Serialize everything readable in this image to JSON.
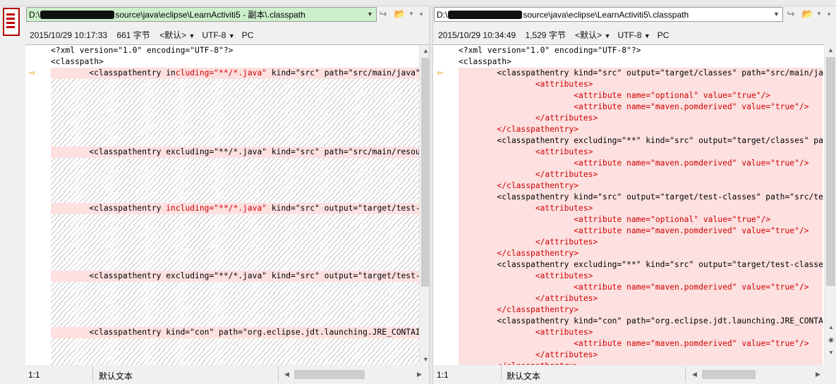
{
  "left": {
    "path_prefix": "D:\\",
    "path_suffix": "source\\java\\eclipse\\LearnActiviti5 - 副本\\.classpath",
    "timestamp": "2015/10/29 10:17:33",
    "size": "661 字节",
    "encoding_mode": "<默认>",
    "charset": "UTF-8",
    "line_ending": "PC",
    "cursor_pos": "1:1",
    "text_mode": "默认文本",
    "lines": [
      {
        "text": "<?xml version=\"1.0\" encoding=\"UTF-8\"?>",
        "style": "normal"
      },
      {
        "text": "<classpath>",
        "style": "normal"
      },
      {
        "pre": "        <classpathentry in",
        "red": "cluding=\"**/*.java\"",
        "post": " kind=\"src\" path=\"src/main/java\"/>",
        "style": "diff"
      },
      {
        "text": "",
        "style": "hatch"
      },
      {
        "text": "",
        "style": "hatch"
      },
      {
        "text": "",
        "style": "hatch"
      },
      {
        "text": "",
        "style": "hatch"
      },
      {
        "text": "",
        "style": "hatch"
      },
      {
        "text": "",
        "style": "hatch"
      },
      {
        "text": "        <classpathentry excluding=\"**/*.java\" kind=\"src\" path=\"src/main/resources\"/>",
        "style": "diff"
      },
      {
        "text": "",
        "style": "hatch"
      },
      {
        "text": "",
        "style": "hatch"
      },
      {
        "text": "",
        "style": "hatch"
      },
      {
        "text": "",
        "style": "hatch"
      },
      {
        "pre": "        <classpathentry ",
        "red": "including=\"**/*.java\"",
        "post": " kind=\"src\" output=\"target/test-classes\"",
        "style": "diff"
      },
      {
        "text": "",
        "style": "hatch"
      },
      {
        "text": "",
        "style": "hatch"
      },
      {
        "text": "",
        "style": "hatch"
      },
      {
        "text": "",
        "style": "hatch"
      },
      {
        "text": "",
        "style": "hatch"
      },
      {
        "text": "        <classpathentry excluding=\"**/*.java\" kind=\"src\" output=\"target/test-classes\"",
        "style": "diff"
      },
      {
        "text": "",
        "style": "hatch"
      },
      {
        "text": "",
        "style": "hatch"
      },
      {
        "text": "",
        "style": "hatch"
      },
      {
        "text": "",
        "style": "hatch"
      },
      {
        "text": "        <classpathentry kind=\"con\" path=\"org.eclipse.jdt.launching.JRE_CONTAINER\"/>",
        "style": "diff"
      },
      {
        "text": "",
        "style": "hatch"
      },
      {
        "text": "",
        "style": "hatch"
      },
      {
        "text": "",
        "style": "hatch"
      }
    ]
  },
  "right": {
    "path_prefix": "D:\\",
    "path_suffix": "source\\java\\eclipse\\LearnActiviti5\\.classpath",
    "timestamp": "2015/10/29 10:34:49",
    "size": "1,529 字节",
    "encoding_mode": "<默认>",
    "charset": "UTF-8",
    "line_ending": "PC",
    "cursor_pos": "1:1",
    "text_mode": "默认文本",
    "lines": [
      {
        "text": "<?xml version=\"1.0\" encoding=\"UTF-8\"?>",
        "style": "normal"
      },
      {
        "text": "<classpath>",
        "style": "normal"
      },
      {
        "text": "        <classpathentry kind=\"src\" output=\"target/classes\" path=\"src/main/java\">",
        "style": "solid"
      },
      {
        "text": "                <attributes>",
        "style": "solid-red"
      },
      {
        "text": "                        <attribute name=\"optional\" value=\"true\"/>",
        "style": "solid-red"
      },
      {
        "text": "                        <attribute name=\"maven.pomderived\" value=\"true\"/>",
        "style": "solid-red"
      },
      {
        "text": "                </attributes>",
        "style": "solid-red"
      },
      {
        "text": "        </classpathentry>",
        "style": "solid-red"
      },
      {
        "text": "        <classpathentry excluding=\"**\" kind=\"src\" output=\"target/classes\" path",
        "style": "solid"
      },
      {
        "text": "                <attributes>",
        "style": "solid-red"
      },
      {
        "text": "                        <attribute name=\"maven.pomderived\" value=\"true\"/>",
        "style": "solid-red"
      },
      {
        "text": "                </attributes>",
        "style": "solid-red"
      },
      {
        "text": "        </classpathentry>",
        "style": "solid-red"
      },
      {
        "text": "        <classpathentry kind=\"src\" output=\"target/test-classes\" path=\"src/test/java\">",
        "style": "solid"
      },
      {
        "text": "                <attributes>",
        "style": "solid-red"
      },
      {
        "text": "                        <attribute name=\"optional\" value=\"true\"/>",
        "style": "solid-red"
      },
      {
        "text": "                        <attribute name=\"maven.pomderived\" value=\"true\"/>",
        "style": "solid-red"
      },
      {
        "text": "                </attributes>",
        "style": "solid-red"
      },
      {
        "text": "        </classpathentry>",
        "style": "solid-red"
      },
      {
        "text": "        <classpathentry excluding=\"**\" kind=\"src\" output=\"target/test-classes\" path",
        "style": "solid"
      },
      {
        "text": "                <attributes>",
        "style": "solid-red"
      },
      {
        "text": "                        <attribute name=\"maven.pomderived\" value=\"true\"/>",
        "style": "solid-red"
      },
      {
        "text": "                </attributes>",
        "style": "solid-red"
      },
      {
        "text": "        </classpathentry>",
        "style": "solid-red"
      },
      {
        "text": "        <classpathentry kind=\"con\" path=\"org.eclipse.jdt.launching.JRE_CONTAINER\">",
        "style": "solid"
      },
      {
        "text": "                <attributes>",
        "style": "solid-red"
      },
      {
        "text": "                        <attribute name=\"maven.pomderived\" value=\"true\"/>",
        "style": "solid-red"
      },
      {
        "text": "                </attributes>",
        "style": "solid-red"
      },
      {
        "text": "        </classpathentry>",
        "style": "solid-red"
      }
    ]
  },
  "colors": {
    "diff_bg": "#fde0e0",
    "path_left_bg": "#ccf0cc",
    "path_right_bg": "#ffffff",
    "red_text": "#d00000",
    "marker": "#d7a100"
  }
}
